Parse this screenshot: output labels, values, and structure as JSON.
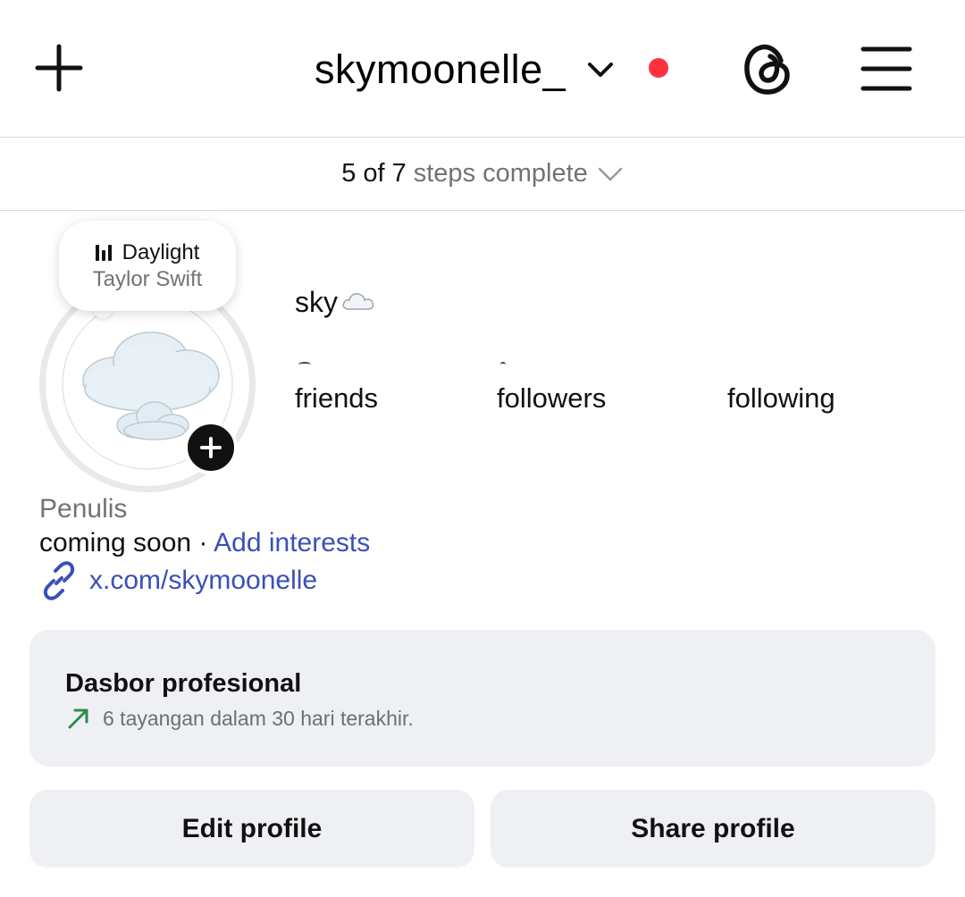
{
  "header": {
    "username": "skymoonelle_",
    "icons": {
      "create": "plus-icon",
      "account_switch": "chevron-down-icon",
      "notification_dot_color": "#ff3040",
      "threads": "threads-icon",
      "menu": "hamburger-menu-icon"
    }
  },
  "steps": {
    "count": "5 of 7",
    "text": "steps complete"
  },
  "note": {
    "song": "Daylight",
    "artist": "Taylor Swift"
  },
  "profile": {
    "display_name": "sky",
    "display_emoji": "☁️",
    "stats": [
      {
        "key": "friends",
        "label": "friends"
      },
      {
        "key": "followers",
        "label": "followers"
      },
      {
        "key": "following",
        "label": "following"
      }
    ],
    "category": "Penulis",
    "bio": "coming soon",
    "bio_separator": " · ",
    "add_interests": "Add interests",
    "link": "x.com/skymoonelle"
  },
  "dashboard": {
    "title": "Dasbor profesional",
    "subtitle": "6 tayangan dalam 30 hari terakhir."
  },
  "buttons": {
    "edit": "Edit profile",
    "share": "Share profile"
  },
  "colors": {
    "link": "#3b4fb8",
    "secondary_text": "#737373",
    "card_bg": "#eff0f3",
    "trend_green": "#2e8b4e"
  }
}
